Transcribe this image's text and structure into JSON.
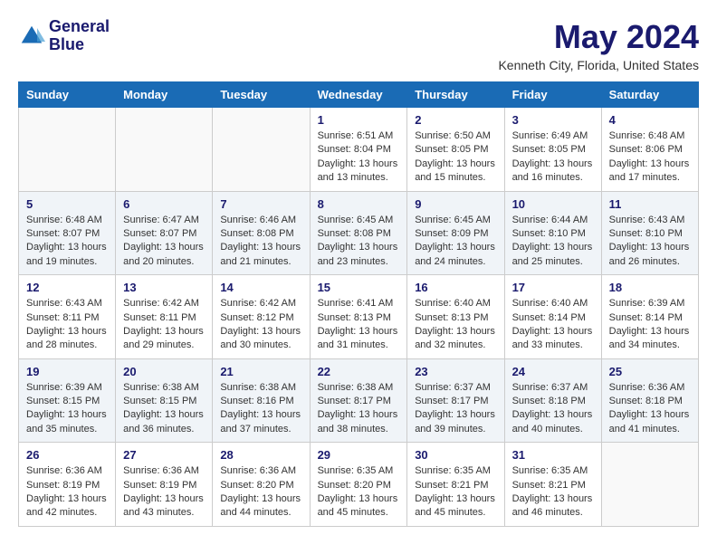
{
  "header": {
    "logo_line1": "General",
    "logo_line2": "Blue",
    "month_year": "May 2024",
    "location": "Kenneth City, Florida, United States"
  },
  "days_of_week": [
    "Sunday",
    "Monday",
    "Tuesday",
    "Wednesday",
    "Thursday",
    "Friday",
    "Saturday"
  ],
  "weeks": [
    [
      {
        "day": "",
        "content": ""
      },
      {
        "day": "",
        "content": ""
      },
      {
        "day": "",
        "content": ""
      },
      {
        "day": "1",
        "content": "Sunrise: 6:51 AM\nSunset: 8:04 PM\nDaylight: 13 hours and 13 minutes."
      },
      {
        "day": "2",
        "content": "Sunrise: 6:50 AM\nSunset: 8:05 PM\nDaylight: 13 hours and 15 minutes."
      },
      {
        "day": "3",
        "content": "Sunrise: 6:49 AM\nSunset: 8:05 PM\nDaylight: 13 hours and 16 minutes."
      },
      {
        "day": "4",
        "content": "Sunrise: 6:48 AM\nSunset: 8:06 PM\nDaylight: 13 hours and 17 minutes."
      }
    ],
    [
      {
        "day": "5",
        "content": "Sunrise: 6:48 AM\nSunset: 8:07 PM\nDaylight: 13 hours and 19 minutes."
      },
      {
        "day": "6",
        "content": "Sunrise: 6:47 AM\nSunset: 8:07 PM\nDaylight: 13 hours and 20 minutes."
      },
      {
        "day": "7",
        "content": "Sunrise: 6:46 AM\nSunset: 8:08 PM\nDaylight: 13 hours and 21 minutes."
      },
      {
        "day": "8",
        "content": "Sunrise: 6:45 AM\nSunset: 8:08 PM\nDaylight: 13 hours and 23 minutes."
      },
      {
        "day": "9",
        "content": "Sunrise: 6:45 AM\nSunset: 8:09 PM\nDaylight: 13 hours and 24 minutes."
      },
      {
        "day": "10",
        "content": "Sunrise: 6:44 AM\nSunset: 8:10 PM\nDaylight: 13 hours and 25 minutes."
      },
      {
        "day": "11",
        "content": "Sunrise: 6:43 AM\nSunset: 8:10 PM\nDaylight: 13 hours and 26 minutes."
      }
    ],
    [
      {
        "day": "12",
        "content": "Sunrise: 6:43 AM\nSunset: 8:11 PM\nDaylight: 13 hours and 28 minutes."
      },
      {
        "day": "13",
        "content": "Sunrise: 6:42 AM\nSunset: 8:11 PM\nDaylight: 13 hours and 29 minutes."
      },
      {
        "day": "14",
        "content": "Sunrise: 6:42 AM\nSunset: 8:12 PM\nDaylight: 13 hours and 30 minutes."
      },
      {
        "day": "15",
        "content": "Sunrise: 6:41 AM\nSunset: 8:13 PM\nDaylight: 13 hours and 31 minutes."
      },
      {
        "day": "16",
        "content": "Sunrise: 6:40 AM\nSunset: 8:13 PM\nDaylight: 13 hours and 32 minutes."
      },
      {
        "day": "17",
        "content": "Sunrise: 6:40 AM\nSunset: 8:14 PM\nDaylight: 13 hours and 33 minutes."
      },
      {
        "day": "18",
        "content": "Sunrise: 6:39 AM\nSunset: 8:14 PM\nDaylight: 13 hours and 34 minutes."
      }
    ],
    [
      {
        "day": "19",
        "content": "Sunrise: 6:39 AM\nSunset: 8:15 PM\nDaylight: 13 hours and 35 minutes."
      },
      {
        "day": "20",
        "content": "Sunrise: 6:38 AM\nSunset: 8:15 PM\nDaylight: 13 hours and 36 minutes."
      },
      {
        "day": "21",
        "content": "Sunrise: 6:38 AM\nSunset: 8:16 PM\nDaylight: 13 hours and 37 minutes."
      },
      {
        "day": "22",
        "content": "Sunrise: 6:38 AM\nSunset: 8:17 PM\nDaylight: 13 hours and 38 minutes."
      },
      {
        "day": "23",
        "content": "Sunrise: 6:37 AM\nSunset: 8:17 PM\nDaylight: 13 hours and 39 minutes."
      },
      {
        "day": "24",
        "content": "Sunrise: 6:37 AM\nSunset: 8:18 PM\nDaylight: 13 hours and 40 minutes."
      },
      {
        "day": "25",
        "content": "Sunrise: 6:36 AM\nSunset: 8:18 PM\nDaylight: 13 hours and 41 minutes."
      }
    ],
    [
      {
        "day": "26",
        "content": "Sunrise: 6:36 AM\nSunset: 8:19 PM\nDaylight: 13 hours and 42 minutes."
      },
      {
        "day": "27",
        "content": "Sunrise: 6:36 AM\nSunset: 8:19 PM\nDaylight: 13 hours and 43 minutes."
      },
      {
        "day": "28",
        "content": "Sunrise: 6:36 AM\nSunset: 8:20 PM\nDaylight: 13 hours and 44 minutes."
      },
      {
        "day": "29",
        "content": "Sunrise: 6:35 AM\nSunset: 8:20 PM\nDaylight: 13 hours and 45 minutes."
      },
      {
        "day": "30",
        "content": "Sunrise: 6:35 AM\nSunset: 8:21 PM\nDaylight: 13 hours and 45 minutes."
      },
      {
        "day": "31",
        "content": "Sunrise: 6:35 AM\nSunset: 8:21 PM\nDaylight: 13 hours and 46 minutes."
      },
      {
        "day": "",
        "content": ""
      }
    ]
  ]
}
